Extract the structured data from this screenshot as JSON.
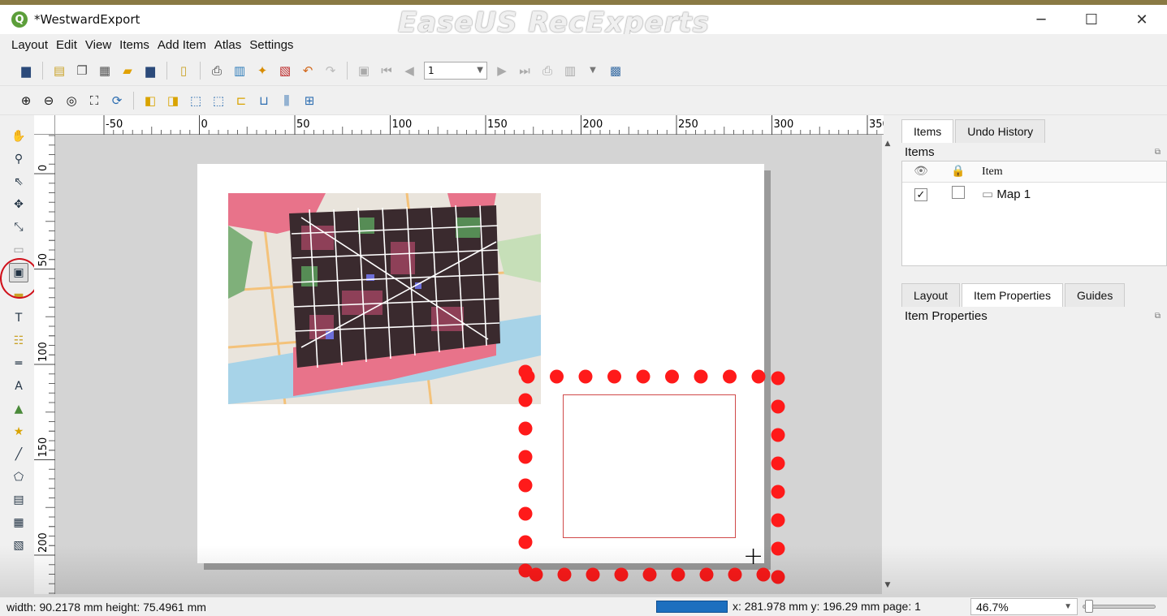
{
  "window": {
    "title": "*WestwardExport",
    "app_icon": "Q",
    "watermark": "EaseUS RecExperts",
    "minimize": "─",
    "maximize": "☐",
    "close": "✕"
  },
  "menu": [
    "Layout",
    "Edit",
    "View",
    "Items",
    "Add Item",
    "Atlas",
    "Settings"
  ],
  "toolbar": {
    "page_value": "1"
  },
  "ruler": {
    "h_labels": [
      "-50",
      "0",
      "50",
      "100",
      "150",
      "200",
      "250",
      "300",
      "350"
    ],
    "v_labels": [
      "0",
      "50",
      "100",
      "150",
      "200"
    ]
  },
  "right_panel": {
    "top_tabs": [
      "Items",
      "Undo History"
    ],
    "items_title": "Items",
    "column_item": "Item",
    "rows": [
      {
        "visible": "✓",
        "name": "Map 1"
      }
    ],
    "bottom_tabs": [
      "Layout",
      "Item Properties",
      "Guides"
    ],
    "props_title": "Item Properties"
  },
  "status": {
    "size_text": "width: 90.2178 mm height: 75.4961 mm",
    "coords_text": "x: 281.978 mm y: 196.29 mm page: 1",
    "zoom": "46.7%"
  },
  "colors": {
    "highlight_dots": "#ff1a1a",
    "selection_ring": "#d0101a",
    "progress": "#1d6fbf"
  }
}
